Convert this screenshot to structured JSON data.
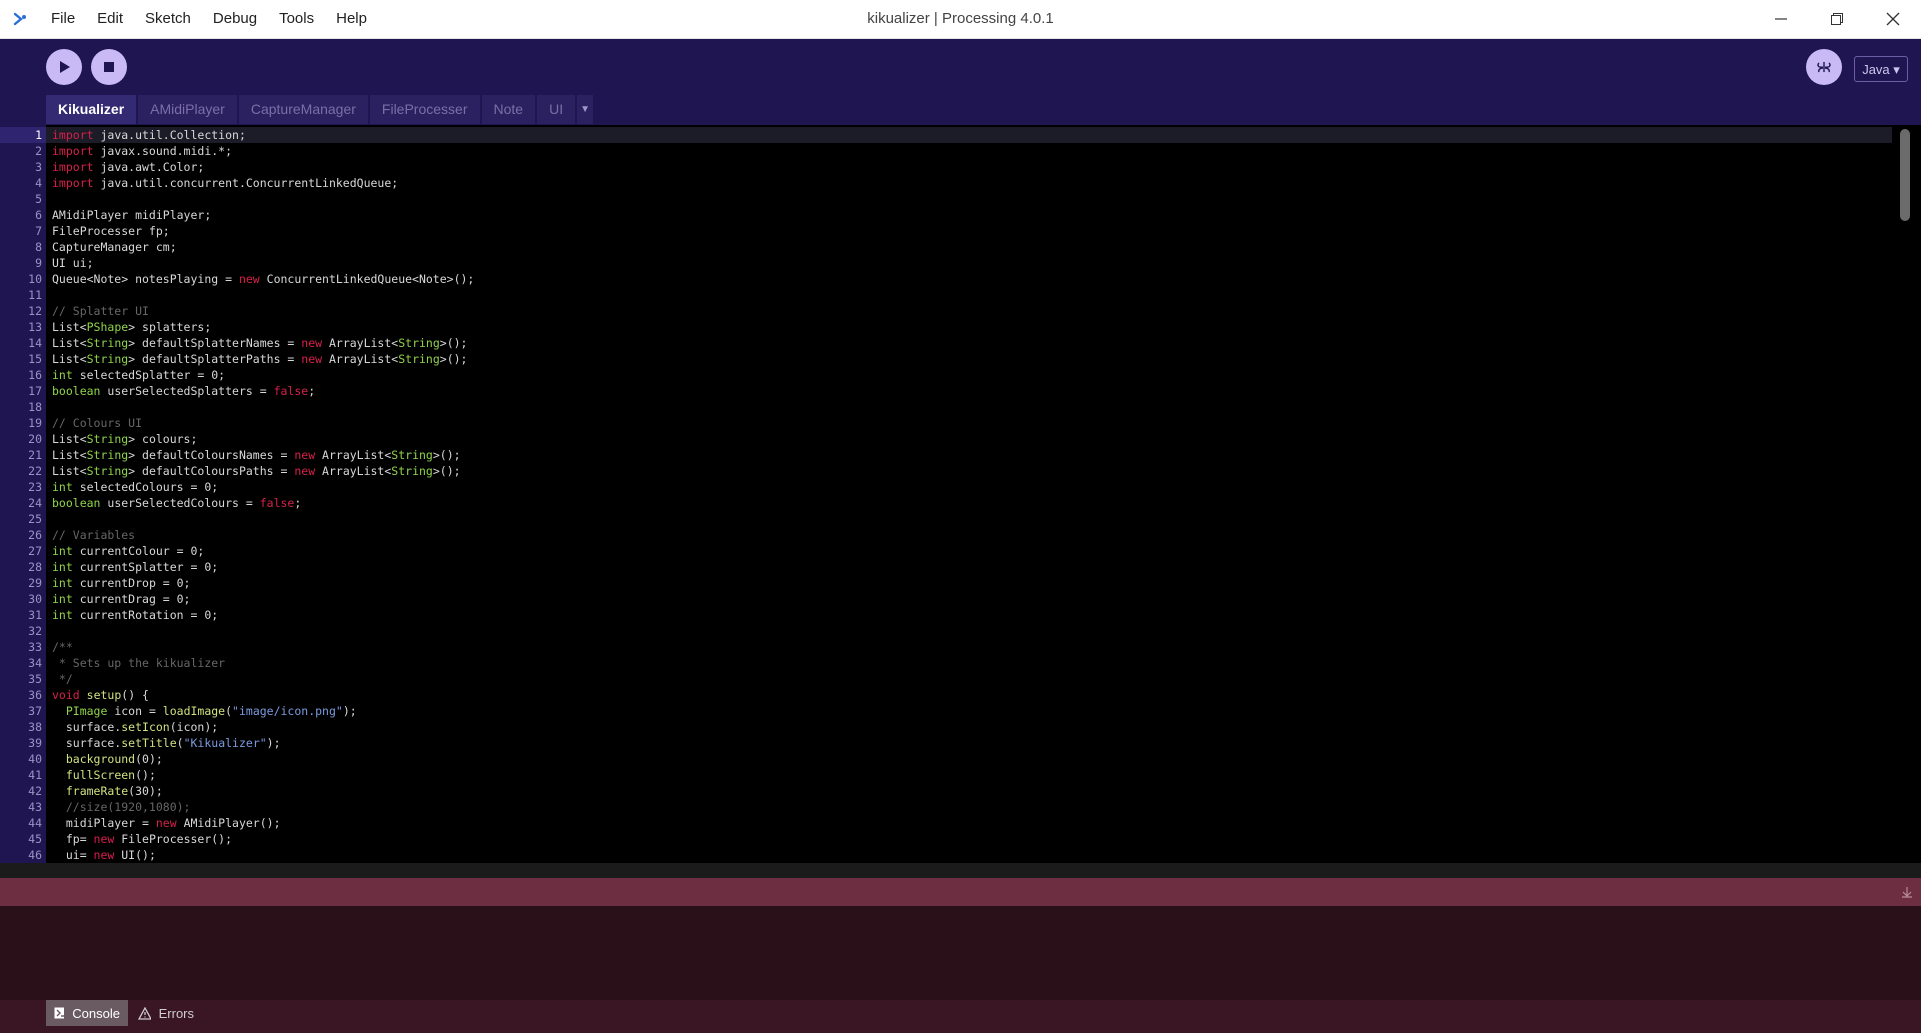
{
  "window": {
    "title": "kikualizer | Processing 4.0.1"
  },
  "menu": [
    "File",
    "Edit",
    "Sketch",
    "Debug",
    "Tools",
    "Help"
  ],
  "toolbar": {
    "mode": "Java ▾"
  },
  "tabs": [
    "Kikualizer",
    "AMidiPlayer",
    "CaptureManager",
    "FileProcesser",
    "Note",
    "UI"
  ],
  "active_tab": "Kikualizer",
  "editor": {
    "current_line": 1,
    "lines": [
      "import java.util.Collection;",
      "import javax.sound.midi.*;",
      "import java.awt.Color;",
      "import java.util.concurrent.ConcurrentLinkedQueue;",
      "",
      "AMidiPlayer midiPlayer;",
      "FileProcesser fp;",
      "CaptureManager cm;",
      "UI ui;",
      "Queue<Note> notesPlaying = new ConcurrentLinkedQueue<Note>();",
      "",
      "// Splatter UI",
      "List<PShape> splatters;",
      "List<String> defaultSplatterNames = new ArrayList<String>();",
      "List<String> defaultSplatterPaths = new ArrayList<String>();",
      "int selectedSplatter = 0;",
      "boolean userSelectedSplatters = false;",
      "",
      "// Colours UI",
      "List<String> colours;",
      "List<String> defaultColoursNames = new ArrayList<String>();",
      "List<String> defaultColoursPaths = new ArrayList<String>();",
      "int selectedColours = 0;",
      "boolean userSelectedColours = false;",
      "",
      "// Variables",
      "int currentColour = 0;",
      "int currentSplatter = 0;",
      "int currentDrop = 0;",
      "int currentDrag = 0;",
      "int currentRotation = 0;",
      "",
      "/**",
      " * Sets up the kikualizer",
      " */",
      "void setup() {",
      "  PImage icon = loadImage(\"image/icon.png\");",
      "  surface.setIcon(icon);",
      "  surface.setTitle(\"Kikualizer\");",
      "  background(0);",
      "  fullScreen();",
      "  frameRate(30);",
      "  //size(1920,1080);",
      "  midiPlayer = new AMidiPlayer();",
      "  fp= new FileProcesser();",
      "  ui= new UI();"
    ]
  },
  "console": {
    "tabs": [
      "Console",
      "Errors"
    ],
    "active": "Console"
  },
  "colors": {
    "toolbar": "#1f1551",
    "accent": "#c9b9f5",
    "status": "#6d2e42"
  }
}
